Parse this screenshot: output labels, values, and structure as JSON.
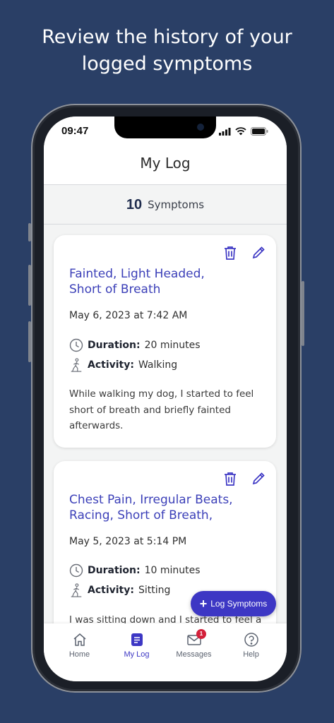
{
  "promo": {
    "line1": "Review the history of your",
    "line2": "logged symptoms"
  },
  "status_bar": {
    "time": "09:47"
  },
  "header": {
    "title": "My Log"
  },
  "summary": {
    "count": "10",
    "label": "Symptoms"
  },
  "entries": [
    {
      "title_line1": "Fainted, Light Headed,",
      "title_line2": "Short of Breath",
      "date": "May 6, 2023 at 7:42 AM",
      "duration_label": "Duration:",
      "duration": "20 minutes",
      "activity_label": "Activity:",
      "activity": "Walking",
      "notes_line1": "While walking my dog, I started to feel",
      "notes_line2": "short of breath and briefly fainted",
      "notes_line3": "afterwards."
    },
    {
      "title_line1": "Chest Pain, Irregular Beats,",
      "title_line2": "Racing, Short of Breath,",
      "date": "May 5, 2023 at 5:14 PM",
      "duration_label": "Duration:",
      "duration": "10 minutes",
      "activity_label": "Activity:",
      "activity": "Sitting",
      "notes_line1": "I was sitting down and I started to feel a"
    }
  ],
  "fab": {
    "label": "Log Symptoms",
    "icon": "plus-icon"
  },
  "tabs": [
    {
      "label": "Home",
      "icon": "home-icon",
      "active": false
    },
    {
      "label": "My Log",
      "icon": "log-icon",
      "active": true
    },
    {
      "label": "Messages",
      "icon": "mail-icon",
      "active": false,
      "badge": "1"
    },
    {
      "label": "Help",
      "icon": "help-icon",
      "active": false
    }
  ],
  "colors": {
    "background": "#2a3f66",
    "accent": "#3d37c4",
    "title_text": "#3b3fb8",
    "badge": "#d3203a"
  }
}
